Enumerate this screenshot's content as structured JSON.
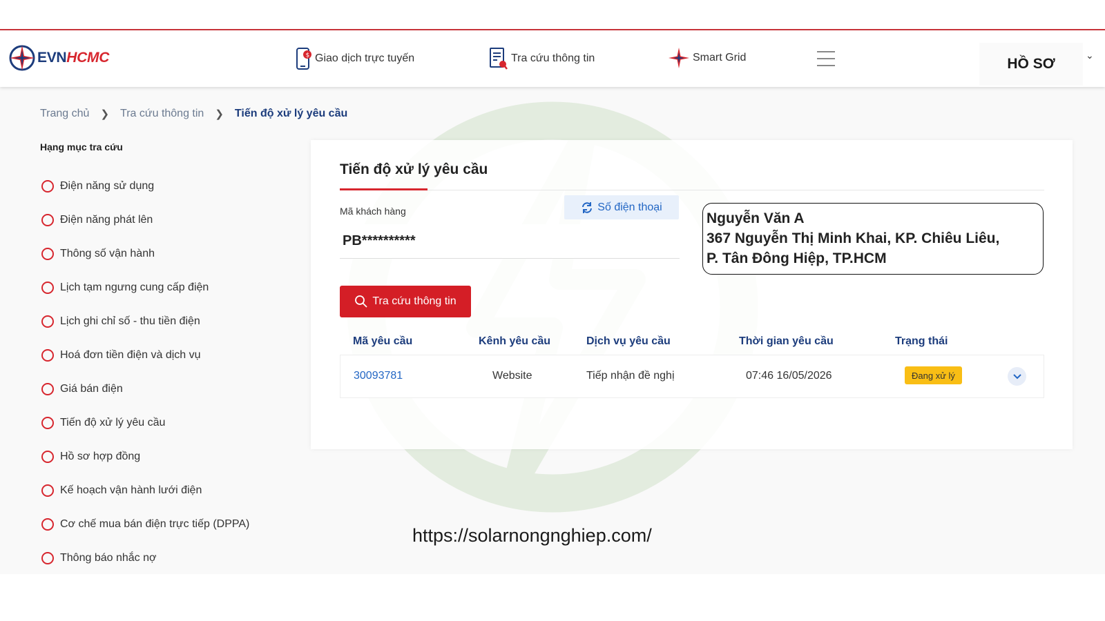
{
  "header": {
    "logo": {
      "part1": "EVN",
      "part2": "HCMC"
    },
    "nav": [
      {
        "label": "Giao dịch trực tuyến"
      },
      {
        "label": "Tra cứu thông tin"
      },
      {
        "label": "Smart Grid"
      }
    ],
    "profile_label": "HỒ SƠ"
  },
  "breadcrumb": {
    "items": [
      "Trang chủ",
      "Tra cứu thông tin"
    ],
    "current": "Tiến độ xử lý yêu cầu"
  },
  "sidebar": {
    "heading": "Hạng mục tra cứu",
    "items": [
      {
        "label": "Điện năng sử dụng"
      },
      {
        "label": "Điện năng phát lên"
      },
      {
        "label": "Thông số vận hành"
      },
      {
        "label": "Lịch tạm ngưng cung cấp điện"
      },
      {
        "label": "Lịch ghi chỉ số - thu tiền điện"
      },
      {
        "label": "Hoá đơn tiền điện và dịch vụ"
      },
      {
        "label": "Giá bán điện"
      },
      {
        "label": "Tiến độ xử lý yêu cầu"
      },
      {
        "label": "Hồ sơ hợp đồng"
      },
      {
        "label": "Kế hoạch vận hành lưới điện"
      },
      {
        "label": "Cơ chế mua bán điện trực tiếp (DPPA)"
      },
      {
        "label": "Thông báo nhắc nợ"
      }
    ]
  },
  "card": {
    "title": "Tiến độ xử lý yêu cầu",
    "customer_label": "Mã khách hàng",
    "customer_value": "PB**********",
    "phone_button": "Số điện thoại",
    "search_button": "Tra cứu thông tin",
    "table": {
      "headers": [
        "Mã yêu cầu",
        "Kênh yêu cầu",
        "Dịch vụ yêu cầu",
        "Thời gian yêu cầu",
        "Trạng thái"
      ],
      "rows": [
        {
          "id": "30093781",
          "channel": "Website",
          "service": "Tiếp nhận đề nghị",
          "time": "07:46 16/05/2026",
          "status": "Đang xử lý"
        }
      ]
    }
  },
  "callout": {
    "line1": "Nguyễn Văn A",
    "line2": "367 Nguyễn Thị Minh Khai, KP. Chiêu Liêu,",
    "line3": "P. Tân Đông Hiệp, TP.HCM"
  },
  "footer": {
    "url": "https://solarnongnghiep.com/"
  },
  "colors": {
    "brand_red": "#d41e26",
    "brand_blue": "#1c3c7c",
    "status_yellow": "#f9be15",
    "link_blue": "#2266c4"
  }
}
